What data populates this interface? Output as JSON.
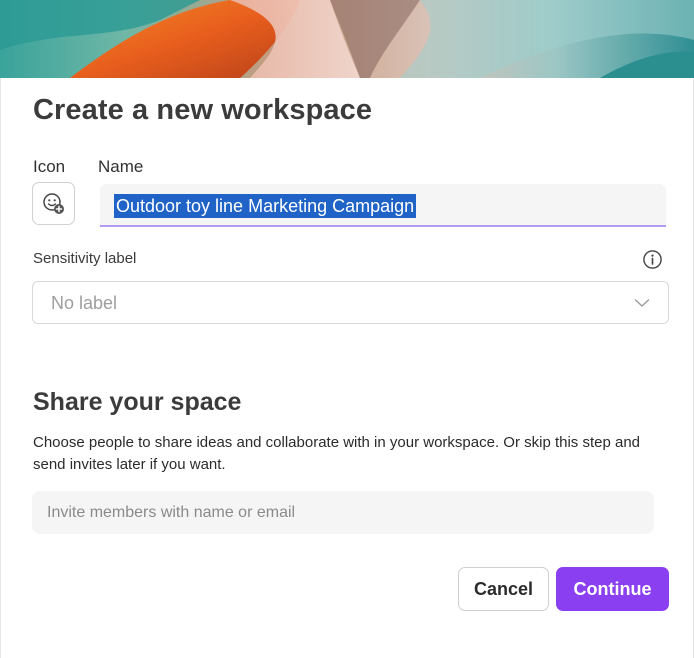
{
  "dialog": {
    "title": "Create a new workspace",
    "icon_label": "Icon",
    "name_label": "Name",
    "name_value": "Outdoor toy line Marketing Campaign",
    "sensitivity": {
      "label": "Sensitivity label",
      "selected": "No label",
      "info_icon": "info-icon",
      "dropdown_icon": "chevron-down-icon"
    },
    "share": {
      "heading": "Share your space",
      "description": "Choose people to share ideas and collaborate with in your workspace. Or skip this step and send invites later if you want.",
      "invite_placeholder": "Invite members with name or email"
    },
    "buttons": {
      "cancel": "Cancel",
      "continue": "Continue"
    },
    "colors": {
      "accent": "#8a3ff0",
      "selection": "#1f63c7",
      "field_underline": "#b49af2"
    }
  }
}
